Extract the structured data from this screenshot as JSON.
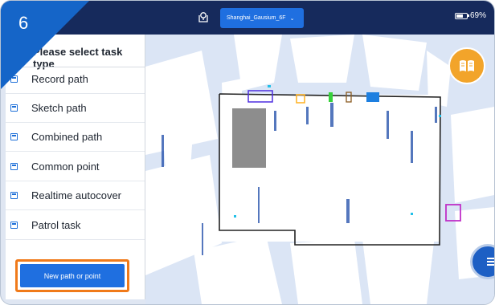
{
  "step_number": "6",
  "header": {
    "site_selector": "Shanghai_Gausium_6F",
    "battery_percent": "69%",
    "battery_level": 0.69
  },
  "task_panel": {
    "title": "Please select task type",
    "items": [
      {
        "label": "Record path"
      },
      {
        "label": "Sketch path"
      },
      {
        "label": "Combined path"
      },
      {
        "label": "Common point"
      },
      {
        "label": "Realtime autocover"
      },
      {
        "label": "Patrol task"
      }
    ],
    "new_button_label": "New path or point"
  },
  "colors": {
    "topbar": "#162a5c",
    "accent_blue": "#1f6fe0",
    "highlight_orange": "#f07a1a",
    "step_corner": "#1565c8",
    "book_button": "#f2a42a"
  },
  "icons": [
    "location-map-icon",
    "chevron-down-icon",
    "battery-icon",
    "task-item-icon",
    "book-icon",
    "menu-icon"
  ]
}
